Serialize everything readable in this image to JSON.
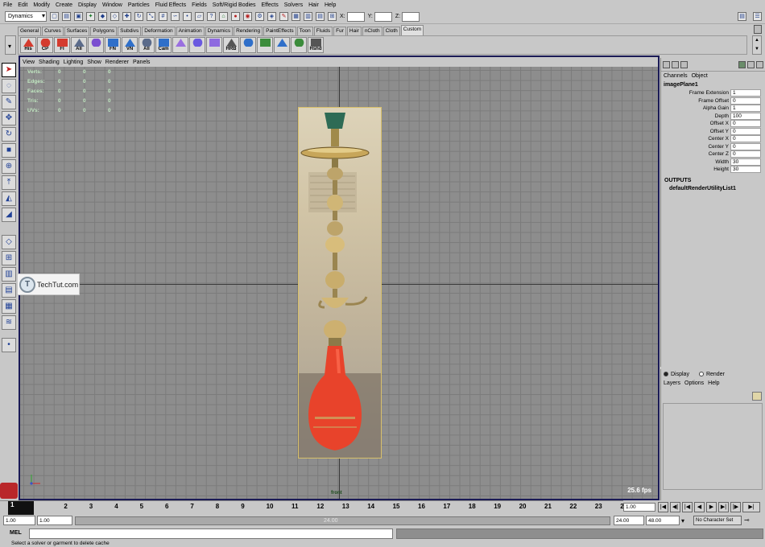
{
  "menubar": [
    "File",
    "Edit",
    "Modify",
    "Create",
    "Display",
    "Window",
    "Particles",
    "Fluid Effects",
    "Fields",
    "Soft/Rigid Bodies",
    "Effects",
    "Solvers",
    "Hair",
    "Help"
  ],
  "statusline": {
    "menuset": "Dynamics",
    "icons": [
      "new-scene-icon",
      "open-scene-icon",
      "save-scene-icon",
      "select-by-hierarchy-icon",
      "select-by-object-icon",
      "select-by-component-icon",
      "snap-grid-icon",
      "snap-curve-icon",
      "snap-point-icon",
      "snap-plane-icon",
      "render-icon",
      "ipr-icon",
      "render-settings-icon"
    ],
    "xyz_labels": [
      "X:",
      "Y:",
      "Z:"
    ]
  },
  "shelf_tabs": [
    "General",
    "Curves",
    "Surfaces",
    "Polygons",
    "Subdivs",
    "Deformation",
    "Animation",
    "Dynamics",
    "Rendering",
    "PaintEffects",
    "Toon",
    "Fluids",
    "Fur",
    "Hair",
    "nCloth",
    "Cloth",
    "Custom"
  ],
  "active_shelf_tab": "Custom",
  "shelf_buttons": [
    "His",
    "CP",
    "FI",
    "All",
    "",
    "FN",
    "VN",
    "All",
    "Cam",
    "",
    "",
    "",
    "HRB",
    "",
    "",
    "",
    "",
    "Hshd"
  ],
  "viewport": {
    "menu": [
      "View",
      "Shading",
      "Lighting",
      "Show",
      "Renderer",
      "Panels"
    ],
    "hud": [
      {
        "label": "Verts:",
        "v1": "0",
        "v2": "0",
        "v3": "0"
      },
      {
        "label": "Edges:",
        "v1": "0",
        "v2": "0",
        "v3": "0"
      },
      {
        "label": "Faces:",
        "v1": "0",
        "v2": "0",
        "v3": "0"
      },
      {
        "label": "Tris:",
        "v1": "0",
        "v2": "0",
        "v3": "0"
      },
      {
        "label": "UVs:",
        "v1": "0",
        "v2": "0",
        "v3": "0"
      }
    ],
    "fps": "25.6 fps",
    "camera": "front"
  },
  "logo": {
    "letter": "T",
    "text": "TechTut.com"
  },
  "channelbox": {
    "menu": [
      "Channels",
      "Object"
    ],
    "object": "imagePlane1",
    "attributes": [
      {
        "name": "Frame Extension",
        "value": "1"
      },
      {
        "name": "Frame Offset",
        "value": "0"
      },
      {
        "name": "Alpha Gain",
        "value": "1"
      },
      {
        "name": "Depth",
        "value": "100"
      },
      {
        "name": "Offset X",
        "value": "0"
      },
      {
        "name": "Offset Y",
        "value": "0"
      },
      {
        "name": "Center X",
        "value": "0"
      },
      {
        "name": "Center Y",
        "value": "0"
      },
      {
        "name": "Center Z",
        "value": "0"
      },
      {
        "name": "Width",
        "value": "30"
      },
      {
        "name": "Height",
        "value": "30"
      }
    ],
    "outputs_label": "OUTPUTS",
    "outputs": [
      "defaultRenderUtilityList1"
    ]
  },
  "layers": {
    "display_label": "Display",
    "render_label": "Render",
    "menu": [
      "Layers",
      "Options",
      "Help"
    ]
  },
  "timeslider": {
    "current": "1",
    "ticks": [
      "2",
      "3",
      "4",
      "5",
      "6",
      "7",
      "8",
      "9",
      "10",
      "11",
      "12",
      "13",
      "14",
      "15",
      "16",
      "17",
      "18",
      "19",
      "20",
      "21",
      "22",
      "23",
      "24"
    ],
    "current_frame_field": "1.00"
  },
  "rangeslider": {
    "start": "1.00",
    "current_start": "1.00",
    "range_label": "24.00",
    "current_end": "24.00",
    "end": "48.00",
    "character_set": "No Character Set"
  },
  "cmdline": {
    "label": "MEL"
  },
  "helpline": "Select a solver or garment to delete cache"
}
